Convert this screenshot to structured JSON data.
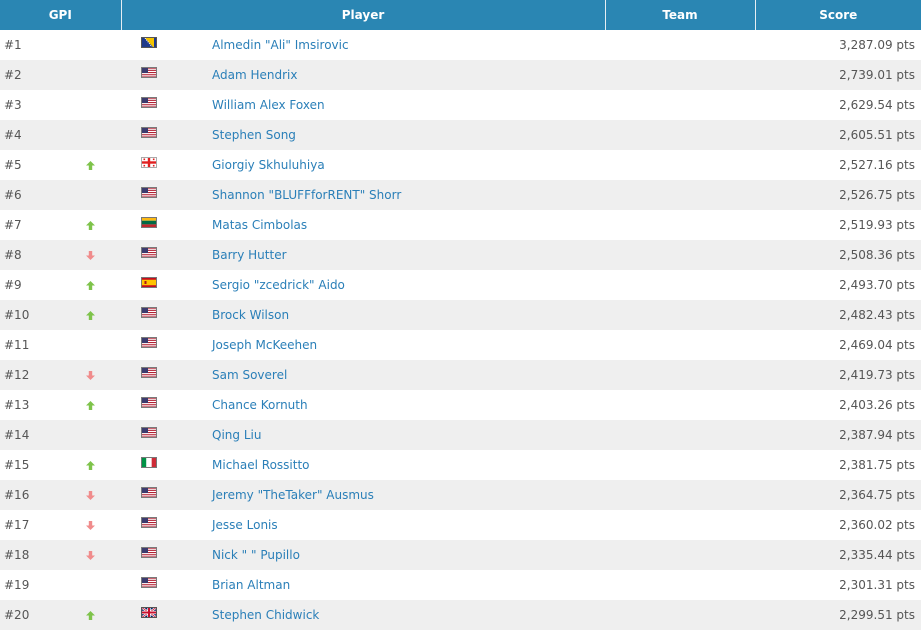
{
  "headers": {
    "gpi": "GPI",
    "player": "Player",
    "team": "Team",
    "score": "Score"
  },
  "colors": {
    "header_bg": "#2a86b3",
    "link": "#2a7fb8",
    "up": "#7ec34a",
    "down": "#f08c8c"
  },
  "rows": [
    {
      "rank": "#1",
      "trend": "none",
      "flag": "bosnia-flag",
      "player": "Almedin \"Ali\" Imsirovic",
      "team": "",
      "score": "3,287.09 pts"
    },
    {
      "rank": "#2",
      "trend": "none",
      "flag": "usa-flag",
      "player": "Adam Hendrix",
      "team": "",
      "score": "2,739.01 pts"
    },
    {
      "rank": "#3",
      "trend": "none",
      "flag": "usa-flag",
      "player": "William Alex Foxen",
      "team": "",
      "score": "2,629.54 pts"
    },
    {
      "rank": "#4",
      "trend": "none",
      "flag": "usa-flag",
      "player": "Stephen Song",
      "team": "",
      "score": "2,605.51 pts"
    },
    {
      "rank": "#5",
      "trend": "up",
      "flag": "georgia-flag",
      "player": "Giorgiy Skhuluhiya",
      "team": "",
      "score": "2,527.16 pts"
    },
    {
      "rank": "#6",
      "trend": "none",
      "flag": "usa-flag",
      "player": "Shannon \"BLUFFforRENT\" Shorr",
      "team": "",
      "score": "2,526.75 pts"
    },
    {
      "rank": "#7",
      "trend": "up",
      "flag": "lithuania-flag",
      "player": "Matas Cimbolas",
      "team": "",
      "score": "2,519.93 pts"
    },
    {
      "rank": "#8",
      "trend": "down",
      "flag": "usa-flag",
      "player": "Barry Hutter",
      "team": "",
      "score": "2,508.36 pts"
    },
    {
      "rank": "#9",
      "trend": "up",
      "flag": "spain-flag",
      "player": "Sergio \"zcedrick\" Aido",
      "team": "",
      "score": "2,493.70 pts"
    },
    {
      "rank": "#10",
      "trend": "up",
      "flag": "usa-flag",
      "player": "Brock Wilson",
      "team": "",
      "score": "2,482.43 pts"
    },
    {
      "rank": "#11",
      "trend": "none",
      "flag": "usa-flag",
      "player": "Joseph McKeehen",
      "team": "",
      "score": "2,469.04 pts"
    },
    {
      "rank": "#12",
      "trend": "down",
      "flag": "usa-flag",
      "player": "Sam Soverel",
      "team": "",
      "score": "2,419.73 pts"
    },
    {
      "rank": "#13",
      "trend": "up",
      "flag": "usa-flag",
      "player": "Chance Kornuth",
      "team": "",
      "score": "2,403.26 pts"
    },
    {
      "rank": "#14",
      "trend": "none",
      "flag": "usa-flag",
      "player": "Qing Liu",
      "team": "",
      "score": "2,387.94 pts"
    },
    {
      "rank": "#15",
      "trend": "up",
      "flag": "italy-flag",
      "player": "Michael Rossitto",
      "team": "",
      "score": "2,381.75 pts"
    },
    {
      "rank": "#16",
      "trend": "down",
      "flag": "usa-flag",
      "player": "Jeremy \"TheTaker\" Ausmus",
      "team": "",
      "score": "2,364.75 pts"
    },
    {
      "rank": "#17",
      "trend": "down",
      "flag": "usa-flag",
      "player": "Jesse Lonis",
      "team": "",
      "score": "2,360.02 pts"
    },
    {
      "rank": "#18",
      "trend": "down",
      "flag": "usa-flag",
      "player": "Nick \" \" Pupillo",
      "team": "",
      "score": "2,335.44 pts"
    },
    {
      "rank": "#19",
      "trend": "none",
      "flag": "usa-flag",
      "player": "Brian Altman",
      "team": "",
      "score": "2,301.31 pts"
    },
    {
      "rank": "#20",
      "trend": "up",
      "flag": "uk-flag",
      "player": "Stephen Chidwick",
      "team": "",
      "score": "2,299.51 pts"
    }
  ]
}
